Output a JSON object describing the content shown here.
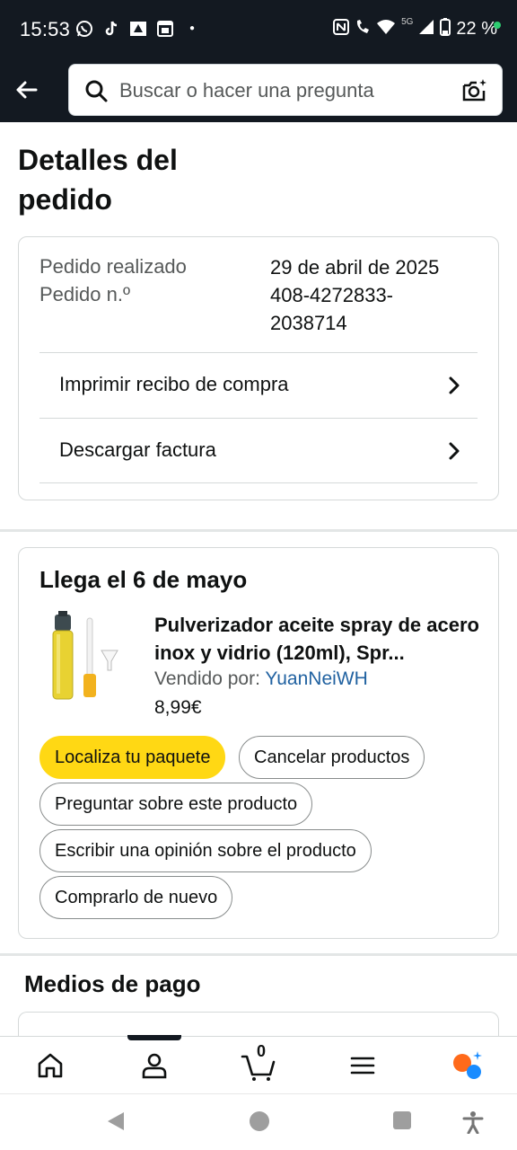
{
  "status_bar": {
    "time": "15:53",
    "battery": "22 %",
    "network": "5G",
    "notification_icons": [
      "whatsapp-icon",
      "tiktok-icon",
      "news-icon",
      "calendar-icon"
    ],
    "system_icons": [
      "nfc-icon",
      "wifi-call-icon",
      "wifi-icon",
      "signal-icon",
      "battery-icon"
    ]
  },
  "header": {
    "search_placeholder": "Buscar o hacer una pregunta",
    "background_color": "#131921"
  },
  "page": {
    "title": "Detalles del pedido"
  },
  "order_info": {
    "placed_label": "Pedido realizado",
    "placed_value": "29 de abril de 2025",
    "number_label": "Pedido n.º",
    "number_value_line1": "408-4272833-",
    "number_value_line2": "2038714",
    "links": [
      {
        "label": "Imprimir recibo de compra"
      },
      {
        "label": "Descargar factura"
      }
    ]
  },
  "shipment": {
    "arrival": "Llega el 6 de mayo",
    "product_title": "Pulverizador aceite spray de acero inox y vidrio (120ml), Spr...",
    "sold_by_label": "Vendido por: ",
    "seller": "YuanNeiWH",
    "price": "8,99€",
    "actions": [
      {
        "label": "Localiza tu paquete",
        "primary": true
      },
      {
        "label": "Cancelar productos"
      },
      {
        "label": "Preguntar sobre este producto"
      },
      {
        "label": "Escribir una opinión sobre el producto"
      },
      {
        "label": "Comprarlo de nuevo"
      }
    ],
    "accent_color": "#ffd814",
    "link_color": "#2162a1"
  },
  "payment": {
    "title": "Medios de pago"
  },
  "bottom_nav": {
    "items": [
      "home-icon",
      "account-icon",
      "cart-icon",
      "menu-icon",
      "rufus-icon"
    ],
    "cart_count": "0",
    "active": "account-icon"
  },
  "android_nav": [
    "back-icon",
    "home-circle-icon",
    "recents-icon",
    "accessibility-icon"
  ]
}
